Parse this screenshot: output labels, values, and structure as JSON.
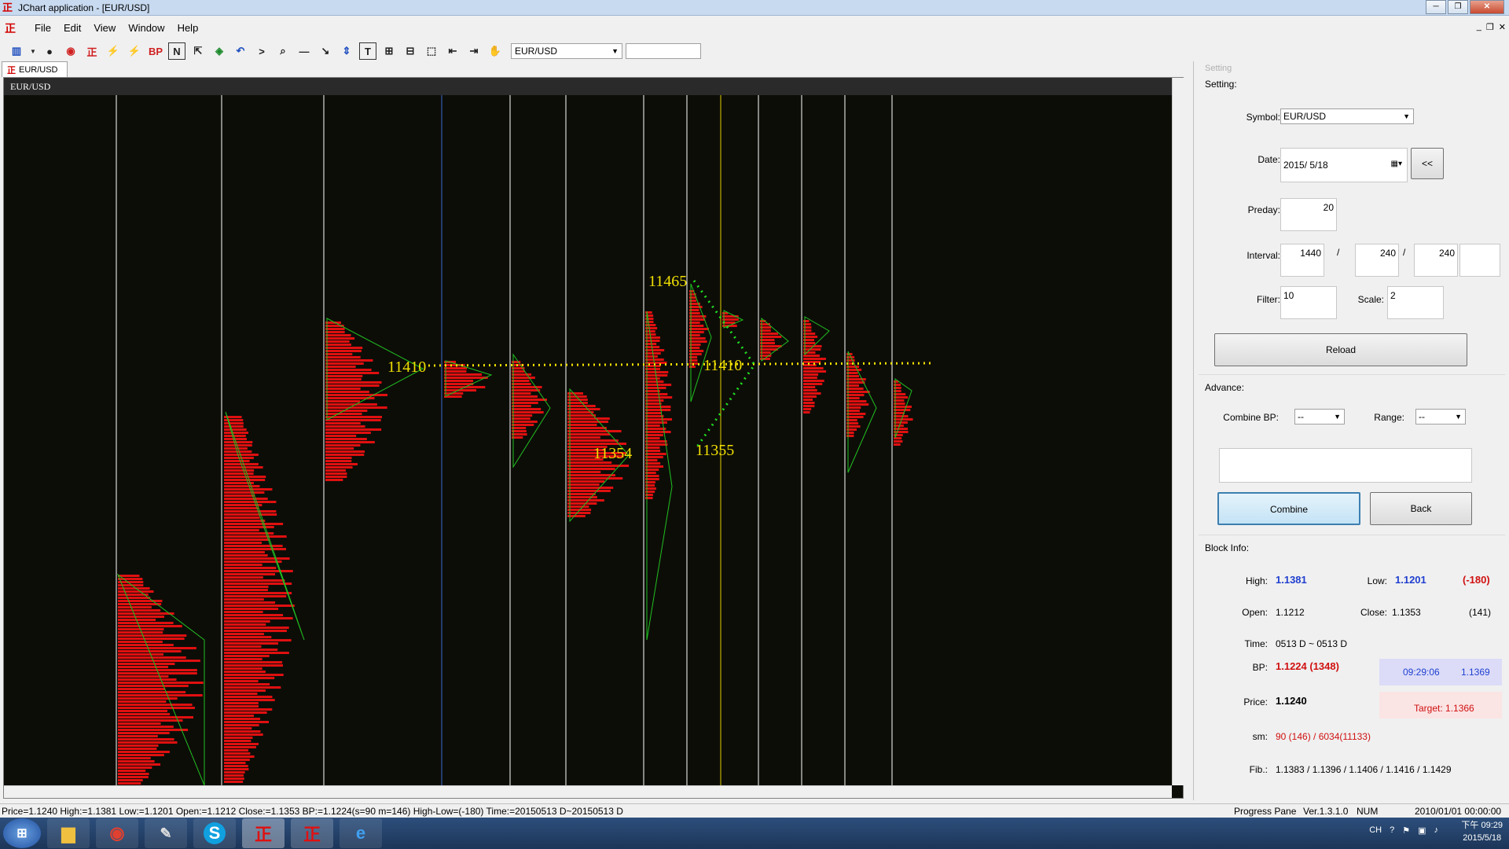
{
  "window": {
    "title": "JChart application - [EUR/USD]"
  },
  "menu": {
    "file": "File",
    "edit": "Edit",
    "view": "View",
    "window": "Window",
    "help": "Help"
  },
  "toolbar": {
    "bp_label": "BP",
    "n_label": "N",
    "t_label": "T",
    "symbol": "EUR/USD",
    "search": ""
  },
  "tab": {
    "label": "EUR/USD"
  },
  "chart": {
    "header": "EUR/USD",
    "annotations": [
      "11465",
      "11410",
      "11410",
      "11354",
      "11355"
    ],
    "colors": {
      "background": "#0d0d08",
      "profile": "#e01010",
      "triangle": "#20c020",
      "dotted_level": "#f0e000",
      "dotted_green": "#20e020",
      "label": "#f0e000",
      "separator": "#ffffff",
      "separator_blue": "#3a6ad0",
      "separator_yellow": "#e0d000"
    }
  },
  "panel": {
    "title": "Setting",
    "setting_label": "Setting:",
    "symbol_label": "Symbol:",
    "symbol_value": "EUR/USD",
    "date_label": "Date:",
    "date_value": "2015/  5/18",
    "date_btn": "<<",
    "preday_label": "Preday:",
    "preday_value": "20",
    "interval_label": "Interval:",
    "interval_1": "1440",
    "interval_2": "240",
    "interval_3": "240",
    "interval_4": "",
    "slash": "/",
    "filter_label": "Filter:",
    "filter_value": "10",
    "scale_label": "Scale:",
    "scale_value": "2",
    "reload": "Reload",
    "advance_label": "Advance:",
    "combine_bp_label": "Combine BP:",
    "combine_bp_value": "--",
    "range_label": "Range:",
    "range_value": "--",
    "memo": "",
    "combine": "Combine",
    "back": "Back",
    "block_info_label": "Block Info:",
    "high_label": "High:",
    "high_value": "1.1381",
    "low_label": "Low:",
    "low_value": "1.1201",
    "diff": "(-180)",
    "open_label": "Open:",
    "open_value": "1.1212",
    "close_label": "Close:",
    "close_value": "1.1353",
    "close_count": "(141)",
    "time_label": "Time:",
    "time_value": "0513 D ~ 0513 D",
    "bp_label": "BP:",
    "bp_value": "1.1224 (1348)",
    "bp_time": "09:29:06",
    "bp_price": "1.1369",
    "price_label": "Price:",
    "price_value": "1.1240",
    "target": "Target: 1.1366",
    "sm_label": "sm:",
    "sm_value": "90 (146) / 6034(11133)",
    "fib_label": "Fib.:",
    "fib_value": "1.1383 / 1.1396 / 1.1406 / 1.1416 / 1.1429"
  },
  "status": {
    "main": "Price=1.1240  High:=1.1381  Low:=1.1201  Open:=1.1212  Close:=1.1353  BP:=1.1224(s=90 m=146)  High-Low=(-180)  Time:=20150513 D~20150513 D",
    "progress": "Progress Pane",
    "version": "Ver.1.3.1.0",
    "num": "NUM",
    "datetime": "2010/01/01 00:00:00"
  },
  "taskbar": {
    "time": "下午 09:29",
    "date": "2015/5/18",
    "lang": "CH"
  }
}
